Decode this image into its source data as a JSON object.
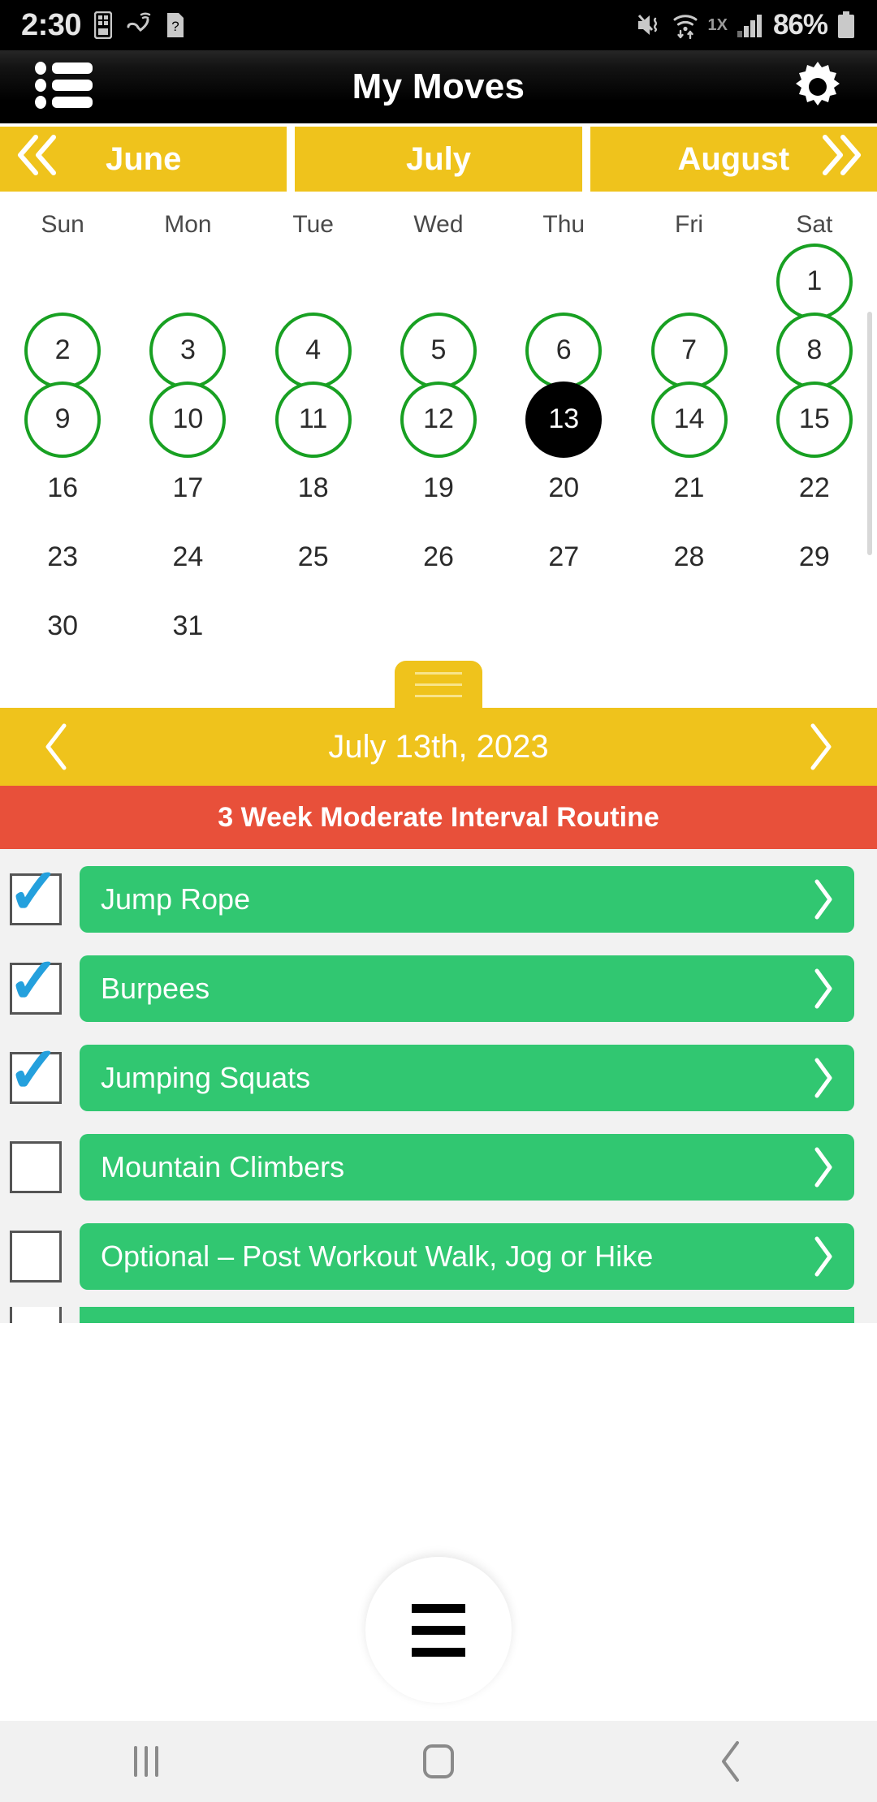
{
  "status_bar": {
    "time": "2:30",
    "battery_percent": "86%",
    "network_mode": "1X",
    "icons": [
      "sim-card-icon",
      "call-wifi-icon",
      "unknown-question-icon",
      "mute-vibrate-icon",
      "wifi-icon",
      "signal-bars-icon",
      "battery-icon"
    ]
  },
  "app_bar": {
    "title": "My Moves",
    "menu_icon": "list-menu-icon",
    "settings_icon": "gear-icon"
  },
  "month_tabs": {
    "prev_icon": "double-chevron-left-icon",
    "next_icon": "double-chevron-right-icon",
    "months": [
      "June",
      "July",
      "August"
    ],
    "active": "July"
  },
  "calendar": {
    "weekdays": [
      "Sun",
      "Mon",
      "Tue",
      "Wed",
      "Thu",
      "Fri",
      "Sat"
    ],
    "rows": [
      [
        {
          "day": "",
          "state": "empty"
        },
        {
          "day": "",
          "state": "empty"
        },
        {
          "day": "",
          "state": "empty"
        },
        {
          "day": "",
          "state": "empty"
        },
        {
          "day": "",
          "state": "empty"
        },
        {
          "day": "",
          "state": "empty"
        },
        {
          "day": "1",
          "state": "marked"
        }
      ],
      [
        {
          "day": "2",
          "state": "marked"
        },
        {
          "day": "3",
          "state": "marked"
        },
        {
          "day": "4",
          "state": "marked"
        },
        {
          "day": "5",
          "state": "marked"
        },
        {
          "day": "6",
          "state": "marked"
        },
        {
          "day": "7",
          "state": "marked"
        },
        {
          "day": "8",
          "state": "marked"
        }
      ],
      [
        {
          "day": "9",
          "state": "marked"
        },
        {
          "day": "10",
          "state": "marked"
        },
        {
          "day": "11",
          "state": "marked"
        },
        {
          "day": "12",
          "state": "marked"
        },
        {
          "day": "13",
          "state": "selected"
        },
        {
          "day": "14",
          "state": "marked"
        },
        {
          "day": "15",
          "state": "marked"
        }
      ],
      [
        {
          "day": "16",
          "state": "plain"
        },
        {
          "day": "17",
          "state": "plain"
        },
        {
          "day": "18",
          "state": "plain"
        },
        {
          "day": "19",
          "state": "plain"
        },
        {
          "day": "20",
          "state": "plain"
        },
        {
          "day": "21",
          "state": "plain"
        },
        {
          "day": "22",
          "state": "plain"
        }
      ],
      [
        {
          "day": "23",
          "state": "plain"
        },
        {
          "day": "24",
          "state": "plain"
        },
        {
          "day": "25",
          "state": "plain"
        },
        {
          "day": "26",
          "state": "plain"
        },
        {
          "day": "27",
          "state": "plain"
        },
        {
          "day": "28",
          "state": "plain"
        },
        {
          "day": "29",
          "state": "plain"
        }
      ],
      [
        {
          "day": "30",
          "state": "plain"
        },
        {
          "day": "31",
          "state": "plain"
        },
        {
          "day": "",
          "state": "empty"
        },
        {
          "day": "",
          "state": "empty"
        },
        {
          "day": "",
          "state": "empty"
        },
        {
          "day": "",
          "state": "empty"
        },
        {
          "day": "",
          "state": "empty"
        }
      ]
    ]
  },
  "drag_handle": {
    "icon": "drag-handle-icon"
  },
  "date_nav": {
    "date": "July 13th, 2023",
    "prev_icon": "chevron-left-icon",
    "next_icon": "chevron-right-icon"
  },
  "routine_banner": {
    "title": "3 Week Moderate Interval Routine"
  },
  "exercises": [
    {
      "label": "Jump Rope",
      "checked": true
    },
    {
      "label": "Burpees",
      "checked": true
    },
    {
      "label": "Jumping Squats",
      "checked": true
    },
    {
      "label": "Mountain Climbers",
      "checked": false
    },
    {
      "label": "Optional – Post Workout Walk, Jog or Hike",
      "checked": false
    }
  ],
  "fab": {
    "icon": "hamburger-menu-icon"
  },
  "nav_bar": {
    "recents_icon": "recents-icon",
    "home_icon": "home-icon",
    "back_icon": "back-icon"
  },
  "colors": {
    "yellow": "#efc31c",
    "green_button": "#31c771",
    "green_ring": "#18a022",
    "red_banner": "#e8503a",
    "check_blue": "#24a0dd",
    "selected_day": "#000000"
  }
}
